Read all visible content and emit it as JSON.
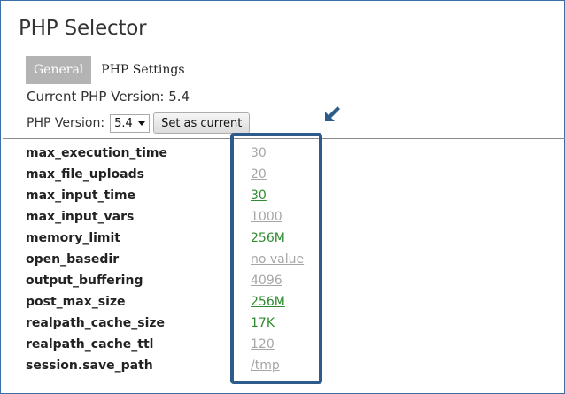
{
  "page": {
    "title": "PHP Selector"
  },
  "tabs": [
    {
      "label": "General",
      "active": true
    },
    {
      "label": "PHP Settings",
      "active": false
    }
  ],
  "current_version": {
    "text": "Current PHP Version: 5.4"
  },
  "version_picker": {
    "label": "PHP Version:",
    "selected": "5.4",
    "button_label": "Set as current"
  },
  "settings": [
    {
      "name": "max_execution_time",
      "value": "30",
      "status": "default"
    },
    {
      "name": "max_file_uploads",
      "value": "20",
      "status": "default"
    },
    {
      "name": "max_input_time",
      "value": "30",
      "status": "changed"
    },
    {
      "name": "max_input_vars",
      "value": "1000",
      "status": "default"
    },
    {
      "name": "memory_limit",
      "value": "256M",
      "status": "changed"
    },
    {
      "name": "open_basedir",
      "value": "no value",
      "status": "default"
    },
    {
      "name": "output_buffering",
      "value": "4096",
      "status": "default"
    },
    {
      "name": "post_max_size",
      "value": "256M",
      "status": "changed"
    },
    {
      "name": "realpath_cache_size",
      "value": "17K",
      "status": "changed"
    },
    {
      "name": "realpath_cache_ttl",
      "value": "120",
      "status": "default"
    },
    {
      "name": "session.save_path",
      "value": "/tmp",
      "status": "default"
    }
  ],
  "colors": {
    "default_value": "#a6a6a6",
    "changed_value": "#2e8b2e",
    "highlight": "#2e5c8a",
    "active_tab": "#b3b3b3"
  },
  "annotation": {
    "icon": "arrow-down-left-icon"
  }
}
